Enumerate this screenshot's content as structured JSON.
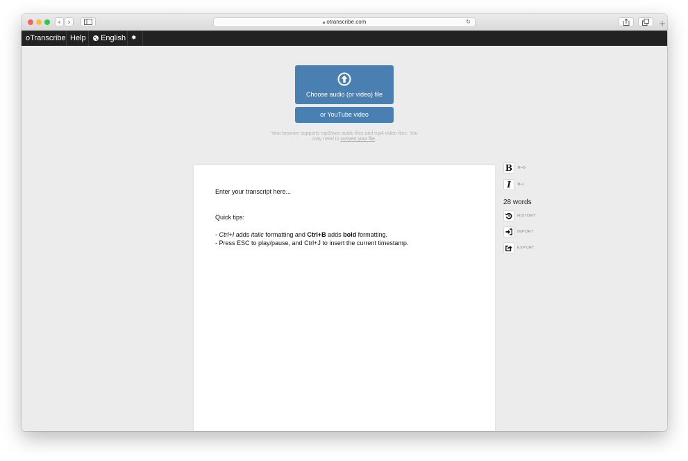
{
  "browser": {
    "url": "otranscribe.com",
    "icons": [
      "back-icon",
      "forward-icon",
      "sidebar-icon",
      "lock-icon",
      "reload-icon",
      "share-icon",
      "tabs-icon",
      "new-tab-icon"
    ],
    "back_glyph": "‹",
    "forward_glyph": "›",
    "reload_glyph": "↻",
    "newtab_glyph": "+"
  },
  "nav": {
    "brand": "oTranscribe",
    "help": "Help",
    "language": "English",
    "globe_glyph": "●",
    "settings_glyph": "✹"
  },
  "upload": {
    "choose_label": "Choose audio (or video) file",
    "youtube_label": "or YouTube video",
    "support_text": "Your browser supports mp3/wav audio files and mp4 video files. You may need to",
    "convert_link": "convert your file",
    "period": "."
  },
  "editor": {
    "placeholder": "Enter your transcript here...",
    "tips_heading": "Quick tips:",
    "tip1": {
      "dash": "- ",
      "ctrl_i": "Ctrl+I",
      "adds": " adds ",
      "italic": "italic",
      "mid": " formatting and ",
      "ctrl_b": "Ctrl+B",
      "adds2": " adds ",
      "bold": "bold",
      "end": " formatting."
    },
    "tip2": "- Press ESC to play/pause, and Ctrl+J to insert the current timestamp."
  },
  "sidebar": {
    "bold_glyph": "B",
    "bold_shortcut": "⌘+B",
    "italic_glyph": "I",
    "italic_shortcut": "⌘+I",
    "word_count": "28 words",
    "history_label": "HISTORY",
    "import_label": "IMPORT",
    "export_label": "EXPORT"
  },
  "colors": {
    "accent": "#4a7fb1",
    "navbar": "#222222",
    "background": "#ececec"
  }
}
